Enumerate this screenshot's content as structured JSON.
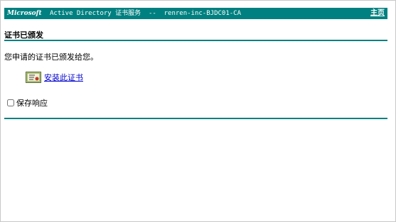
{
  "banner": {
    "brand": "Microsoft",
    "title": "Active Directory 证书服务  --  renren-inc-BJDC01-CA",
    "home_link": "主页"
  },
  "page": {
    "heading": "证书已颁发",
    "message": "您申请的证书已颁发给您。",
    "install_link": "安装此证书",
    "save_response_label": "保存响应"
  },
  "colors": {
    "accent": "#008080",
    "link": "#0000cc"
  },
  "icons": {
    "certificate": "certificate-icon"
  }
}
